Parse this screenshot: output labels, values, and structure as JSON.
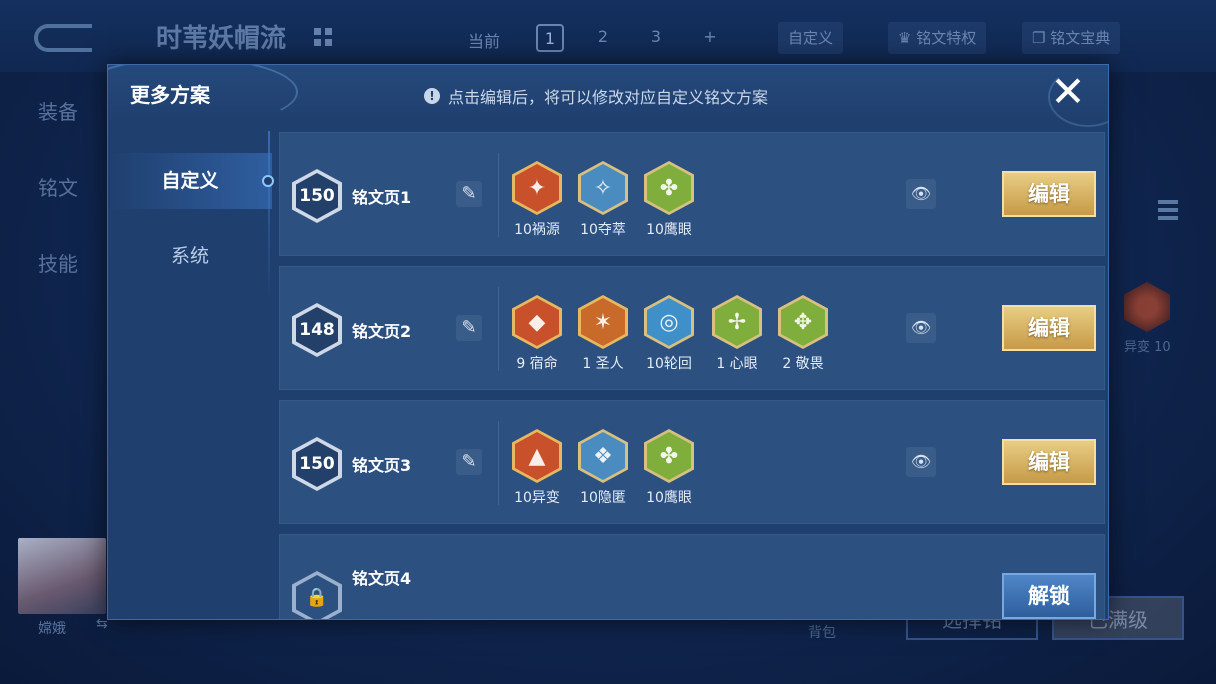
{
  "background": {
    "title": "时苇妖帽流",
    "current_label": "当前",
    "page_numbers": [
      "1",
      "2",
      "3",
      "+"
    ],
    "custom_tab": "自定义",
    "privilege_tab": "铭文特权",
    "codex_tab": "铭文宝典",
    "side_menu": [
      "装备",
      "铭文",
      "技能"
    ],
    "right_rune_label": "异变 10",
    "hero_name": "嫦娥",
    "swap_symbol": "⇆",
    "bag_label": "背包",
    "choose_button": "选择铭",
    "full_level_button": "已满级"
  },
  "modal": {
    "title": "更多方案",
    "hint": "点击编辑后，将可以修改对应自定义铭文方案",
    "close_symbol": "✕",
    "tabs": [
      "自定义",
      "系统"
    ]
  },
  "pages": [
    {
      "level": "150",
      "name": "铭文页1",
      "runes": [
        {
          "label": "10祸源",
          "color": "#c8502a",
          "glyph": "✦"
        },
        {
          "label": "10夺萃",
          "color": "#4a8bc0",
          "glyph": "✧"
        },
        {
          "label": "10鹰眼",
          "color": "#7fae3c",
          "glyph": "✤"
        }
      ],
      "action": "编辑"
    },
    {
      "level": "148",
      "name": "铭文页2",
      "runes": [
        {
          "label": "9 宿命",
          "color": "#c8502a",
          "glyph": "◆"
        },
        {
          "label": "1 圣人",
          "color": "#c86a2a",
          "glyph": "✶"
        },
        {
          "label": "10轮回",
          "color": "#3f8fc8",
          "glyph": "◎"
        },
        {
          "label": "1 心眼",
          "color": "#7fae3c",
          "glyph": "✢"
        },
        {
          "label": "2 敬畏",
          "color": "#7fae3c",
          "glyph": "✥"
        }
      ],
      "action": "编辑"
    },
    {
      "level": "150",
      "name": "铭文页3",
      "runes": [
        {
          "label": "10异变",
          "color": "#c8502a",
          "glyph": "▲"
        },
        {
          "label": "10隐匿",
          "color": "#4a8bc0",
          "glyph": "❖"
        },
        {
          "label": "10鹰眼",
          "color": "#7fae3c",
          "glyph": "✤"
        }
      ],
      "action": "编辑"
    },
    {
      "name": "铭文页4",
      "locked": true,
      "action": "解锁"
    }
  ]
}
